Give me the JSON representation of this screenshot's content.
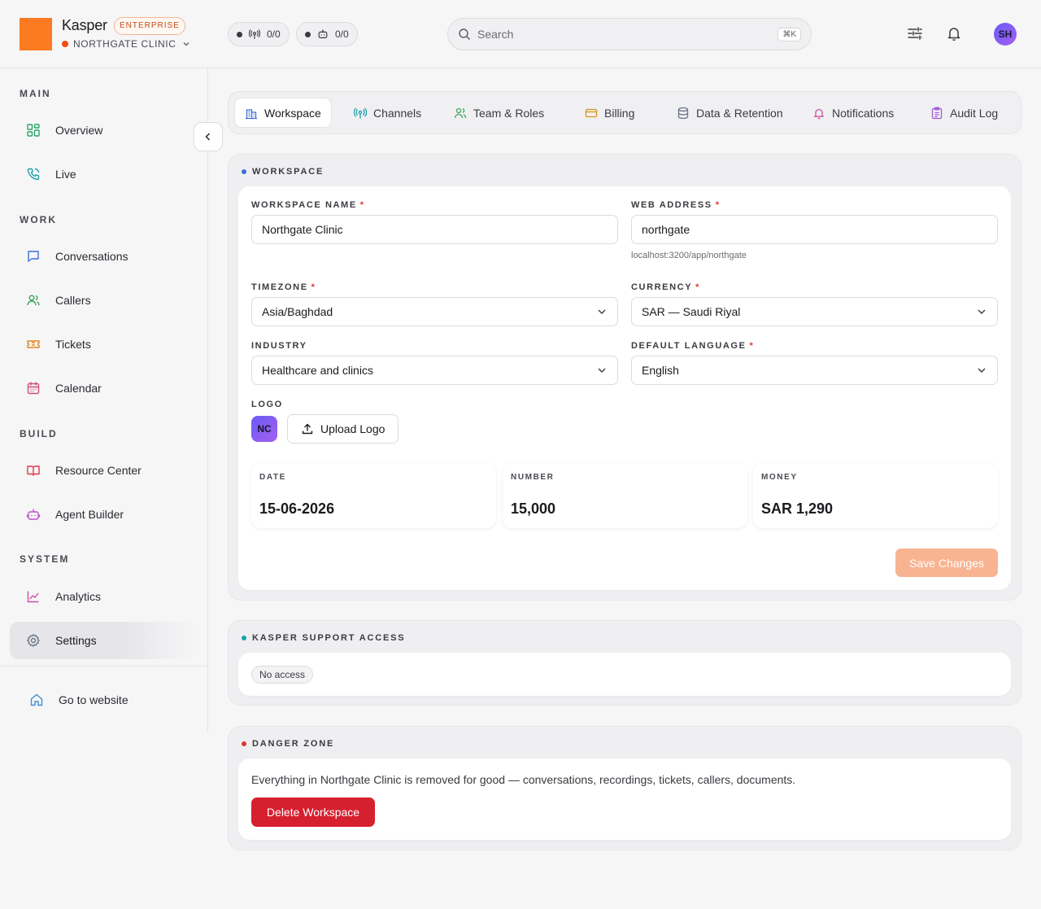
{
  "header": {
    "brand": "Kasper",
    "plan_badge": "ENTERPRISE",
    "workspace_selector": "NORTHGATE CLINIC",
    "channel_status_1": "0/0",
    "channel_status_2": "0/0",
    "search_placeholder": "Search",
    "search_shortcut": "⌘K",
    "avatar_initials": "SH"
  },
  "sidebar": {
    "sections": [
      {
        "label": "MAIN",
        "items": [
          {
            "label": "Overview",
            "icon": "grid-icon"
          },
          {
            "label": "Live",
            "icon": "phone-icon"
          }
        ]
      },
      {
        "label": "WORK",
        "items": [
          {
            "label": "Conversations",
            "icon": "chat-icon"
          },
          {
            "label": "Callers",
            "icon": "users-icon"
          },
          {
            "label": "Tickets",
            "icon": "ticket-icon"
          },
          {
            "label": "Calendar",
            "icon": "calendar-icon"
          }
        ]
      },
      {
        "label": "BUILD",
        "items": [
          {
            "label": "Resource Center",
            "icon": "book-icon"
          },
          {
            "label": "Agent Builder",
            "icon": "bot-icon"
          }
        ]
      },
      {
        "label": "SYSTEM",
        "items": [
          {
            "label": "Analytics",
            "icon": "chart-icon"
          },
          {
            "label": "Settings",
            "icon": "gear-icon"
          }
        ]
      }
    ],
    "footer_link": "Go to website",
    "active_item": "Settings"
  },
  "tabs": [
    {
      "label": "Workspace",
      "icon": "building-icon",
      "color": "#3b6fd8"
    },
    {
      "label": "Channels",
      "icon": "antenna-icon",
      "color": "#1a9fb0"
    },
    {
      "label": "Team & Roles",
      "icon": "users-icon",
      "color": "#3aa55a"
    },
    {
      "label": "Billing",
      "icon": "card-icon",
      "color": "#d8921c"
    },
    {
      "label": "Data & Retention",
      "icon": "database-icon",
      "color": "#6a7384"
    },
    {
      "label": "Notifications",
      "icon": "bell-icon",
      "color": "#d04fa0"
    },
    {
      "label": "Audit Log",
      "icon": "clipboard-icon",
      "color": "#a05ad8"
    }
  ],
  "workspace": {
    "title": "WORKSPACE",
    "name_label": "WORKSPACE NAME",
    "name_value": "Northgate Clinic",
    "web_label": "WEB ADDRESS",
    "web_value": "northgate",
    "web_hint": "localhost:3200/app/northgate",
    "timezone_label": "TIMEZONE",
    "timezone_value": "Asia/Baghdad",
    "currency_label": "CURRENCY",
    "currency_value": "SAR — Saudi Riyal",
    "industry_label": "INDUSTRY",
    "industry_value": "Healthcare and clinics",
    "language_label": "DEFAULT LANGUAGE",
    "language_value": "English",
    "logo_label": "LOGO",
    "logo_initials": "NC",
    "upload_label": "Upload Logo",
    "stats": [
      {
        "label": "DATE",
        "value": "15-06-2026"
      },
      {
        "label": "NUMBER",
        "value": "15,000"
      },
      {
        "label": "MONEY",
        "value": "SAR 1,290"
      }
    ],
    "save_label": "Save Changes"
  },
  "support": {
    "title": "KASPER SUPPORT ACCESS",
    "status": "No access"
  },
  "danger": {
    "title": "DANGER ZONE",
    "description": "Everything in Northgate Clinic is removed for good — conversations, recordings, tickets, callers, documents.",
    "delete_label": "Delete Workspace"
  },
  "colors": {
    "accent": "#fb7a22",
    "danger": "#d7202f",
    "save_disabled": "#f8b391"
  }
}
